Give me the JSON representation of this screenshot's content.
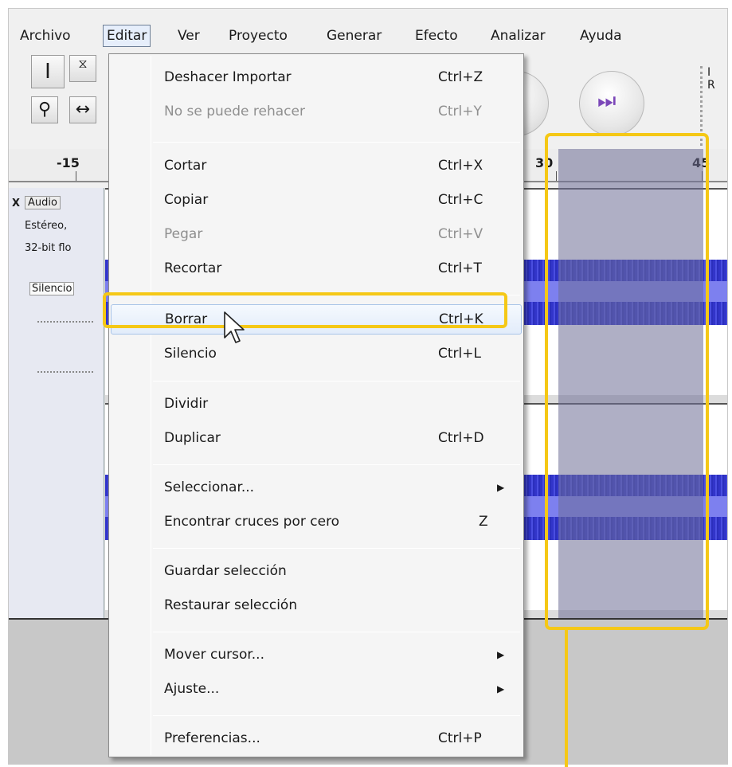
{
  "menubar": {
    "items": [
      "Archivo",
      "Editar",
      "Ver",
      "Proyecto",
      "Generar",
      "Efecto",
      "Analizar",
      "Ayuda"
    ],
    "active": "Editar"
  },
  "toolbar": {
    "select_tool_icon": "ibeam-cursor-icon",
    "envelope_tool_icon": "envelope-icon",
    "zoom_tool_icon": "magnifier-icon",
    "timeshift_tool_icon": "timeshift-icon",
    "stop_icon": "stop-icon",
    "skip_end_icon": "skip-to-end-icon",
    "meter_labels": [
      "I",
      "R"
    ]
  },
  "ruler": {
    "labels": [
      "-15",
      "30",
      "45"
    ]
  },
  "track": {
    "close_label": "X",
    "name": "Audio",
    "info_line1": "Estéreo,",
    "info_line2": "32-bit flo",
    "silence_label": "Silencio"
  },
  "edit_menu": {
    "items": [
      {
        "label": "Deshacer Importar",
        "shortcut": "Ctrl+Z",
        "enabled": true
      },
      {
        "label": "No se puede rehacer",
        "shortcut": "Ctrl+Y",
        "enabled": false
      },
      {
        "label": "Cortar",
        "shortcut": "Ctrl+X",
        "enabled": true
      },
      {
        "label": "Copiar",
        "shortcut": "Ctrl+C",
        "enabled": true
      },
      {
        "label": "Pegar",
        "shortcut": "Ctrl+V",
        "enabled": false
      },
      {
        "label": "Recortar",
        "shortcut": "Ctrl+T",
        "enabled": true
      },
      {
        "label": "Borrar",
        "shortcut": "Ctrl+K",
        "enabled": true,
        "hovered": true
      },
      {
        "label": "Silencio",
        "shortcut": "Ctrl+L",
        "enabled": true
      },
      {
        "label": "Dividir",
        "shortcut": "",
        "enabled": true
      },
      {
        "label": "Duplicar",
        "shortcut": "Ctrl+D",
        "enabled": true
      },
      {
        "label": "Seleccionar...",
        "shortcut": "",
        "submenu": true,
        "enabled": true
      },
      {
        "label": "Encontrar cruces por cero",
        "shortcut": "Z",
        "enabled": true
      },
      {
        "label": "Guardar selección",
        "shortcut": "",
        "enabled": true
      },
      {
        "label": "Restaurar selección",
        "shortcut": "",
        "enabled": true
      },
      {
        "label": "Mover cursor...",
        "shortcut": "",
        "submenu": true,
        "enabled": true
      },
      {
        "label": "Ajuste...",
        "shortcut": "",
        "submenu": true,
        "enabled": true
      },
      {
        "label": "Preferencias...",
        "shortcut": "Ctrl+P",
        "enabled": true
      }
    ]
  },
  "colors": {
    "highlight": "#f5c816",
    "waveform": "#3235c9",
    "selection": "#8a8aa6",
    "disabled_text": "#8f8f8f"
  }
}
